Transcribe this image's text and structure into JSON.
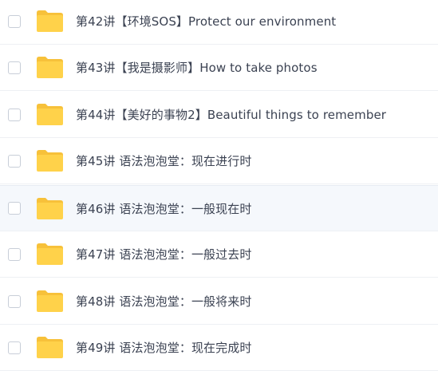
{
  "file_list": {
    "items": [
      {
        "name": "第42讲【环境SOS】Protect our environment",
        "type": "folder",
        "checked": false
      },
      {
        "name": "第43讲【我是摄影师】How to take photos",
        "type": "folder",
        "checked": false
      },
      {
        "name": "第44讲【美好的事物2】Beautiful things to remember",
        "type": "folder",
        "checked": false
      },
      {
        "name": "第45讲 语法泡泡堂：现在进行时",
        "type": "folder",
        "checked": false
      },
      {
        "name": "第46讲 语法泡泡堂：一般现在时",
        "type": "folder",
        "checked": false,
        "hovered": true
      },
      {
        "name": "第47讲 语法泡泡堂：一般过去时",
        "type": "folder",
        "checked": false
      },
      {
        "name": "第48讲 语法泡泡堂：一般将来时",
        "type": "folder",
        "checked": false
      },
      {
        "name": "第49讲 语法泡泡堂：现在完成时",
        "type": "folder",
        "checked": false
      }
    ]
  },
  "colors": {
    "folder": "#FFD24A",
    "folder_tab": "#F7C13A",
    "text": "#3b4252",
    "hover_bg": "#f5f8fc",
    "divider": "#eef0f4"
  },
  "icons": {
    "folder": "folder-icon"
  }
}
